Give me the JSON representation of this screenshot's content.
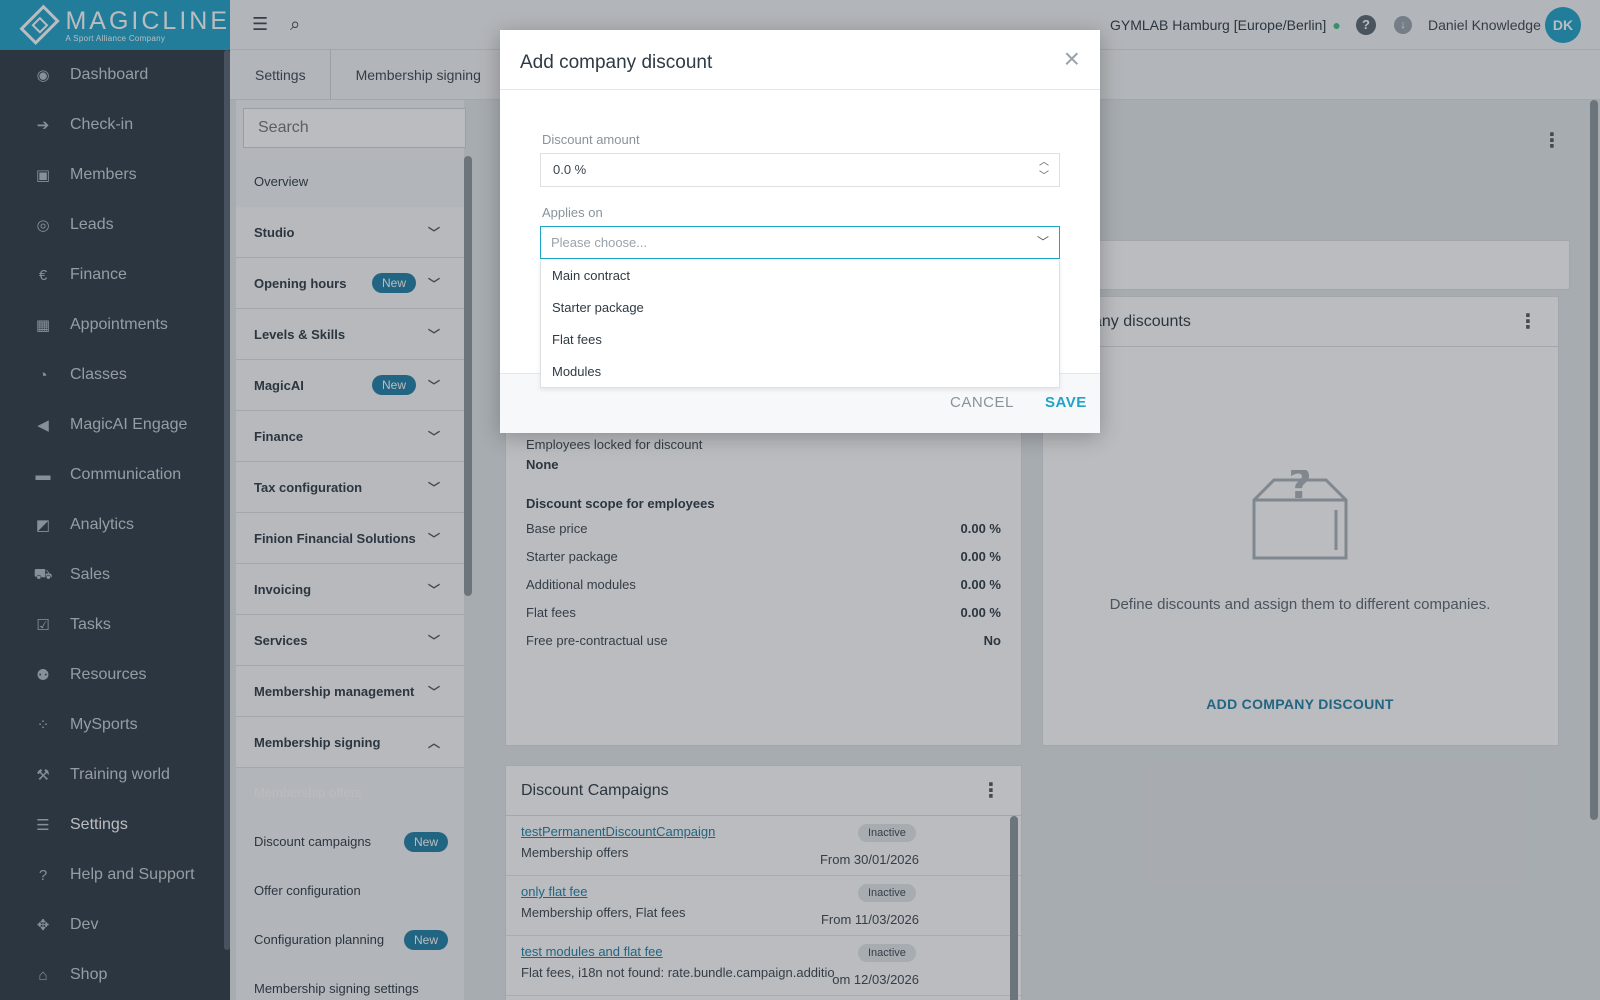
{
  "brand": {
    "name": "MAGICLINE",
    "tagline": "A Sport Alliance Company"
  },
  "nav": {
    "items": [
      {
        "label": "Dashboard",
        "icon": "◉"
      },
      {
        "label": "Check-in",
        "icon": "➔"
      },
      {
        "label": "Members",
        "icon": "▣"
      },
      {
        "label": "Leads",
        "icon": "◎"
      },
      {
        "label": "Finance",
        "icon": "€"
      },
      {
        "label": "Appointments",
        "icon": "▦"
      },
      {
        "label": "Classes",
        "icon": "◔"
      },
      {
        "label": "MagicAI Engage",
        "icon": "◀"
      },
      {
        "label": "Communication",
        "icon": "▬"
      },
      {
        "label": "Analytics",
        "icon": "◩"
      },
      {
        "label": "Sales",
        "icon": "⛟"
      },
      {
        "label": "Tasks",
        "icon": "☑"
      },
      {
        "label": "Resources",
        "icon": "⚉"
      },
      {
        "label": "MySports",
        "icon": "⁘"
      },
      {
        "label": "Training world",
        "icon": "⚒"
      },
      {
        "label": "Settings",
        "icon": "☰"
      },
      {
        "label": "Help and Support",
        "icon": "?"
      },
      {
        "label": "Dev",
        "icon": "✥"
      },
      {
        "label": "Shop",
        "icon": "⌂"
      }
    ]
  },
  "topbar": {
    "studio": "GYMLAB Hamburg [Europe/Berlin]",
    "user": "Daniel Knowledge",
    "avatar": "DK"
  },
  "breadcrumb": [
    "Settings",
    "Membership signing"
  ],
  "settings_menu": {
    "search_placeholder": "Search",
    "items": [
      {
        "label": "Overview"
      },
      {
        "label": "Studio"
      },
      {
        "label": "Opening hours",
        "badge": "New"
      },
      {
        "label": "Levels & Skills"
      },
      {
        "label": "MagicAI",
        "badge": "New"
      },
      {
        "label": "Finance"
      },
      {
        "label": "Tax configuration"
      },
      {
        "label": "Finion Financial Solutions"
      },
      {
        "label": "Invoicing"
      },
      {
        "label": "Services"
      },
      {
        "label": "Membership management"
      },
      {
        "label": "Membership signing"
      },
      {
        "label": "Membership offers"
      },
      {
        "label": "Discount campaigns",
        "badge": "New"
      },
      {
        "label": "Offer configuration"
      },
      {
        "label": "Configuration planning",
        "badge": "New"
      },
      {
        "label": "Membership signing settings"
      }
    ]
  },
  "discount_details": {
    "locked_label": "Employees locked for discount",
    "locked_value": "None",
    "scope_title": "Discount scope for employees",
    "rows": [
      {
        "label": "Base price",
        "value": "0.00 %"
      },
      {
        "label": "Starter package",
        "value": "0.00 %"
      },
      {
        "label": "Additional modules",
        "value": "0.00 %"
      },
      {
        "label": "Flat fees",
        "value": "0.00 %"
      },
      {
        "label": "Free pre-contractual use",
        "value": "No"
      }
    ]
  },
  "company_discounts": {
    "title": "any discounts",
    "empty_text": "Define discounts and assign them to different companies.",
    "add_label": "ADD COMPANY DISCOUNT"
  },
  "campaigns": {
    "title": "Discount Campaigns",
    "items": [
      {
        "name": "testPermanentDiscountCampaign",
        "desc": "Membership offers",
        "status": "Inactive",
        "from": "From 30/01/2026"
      },
      {
        "name": "only flat fee",
        "desc": "Membership offers, Flat fees",
        "status": "Inactive",
        "from": "From 11/03/2026"
      },
      {
        "name": "test modules and flat fee",
        "desc": "Flat fees, i18n not found: rate.bundle.campaign.additio",
        "status": "Inactive",
        "from": "om 12/03/2026"
      }
    ]
  },
  "modal": {
    "title": "Add company discount",
    "close": "×",
    "amount_label": "Discount amount",
    "amount_value": "0.0 %",
    "applies_label": "Applies on",
    "applies_placeholder": "Please choose...",
    "options": [
      "Main contract",
      "Starter package",
      "Flat fees",
      "Modules"
    ],
    "cancel": "CANCEL",
    "save": "SAVE"
  },
  "colors": {
    "accent": "#1fa3c9",
    "nav_bg": "#2e3a44",
    "badge": "#1f7fa6"
  }
}
